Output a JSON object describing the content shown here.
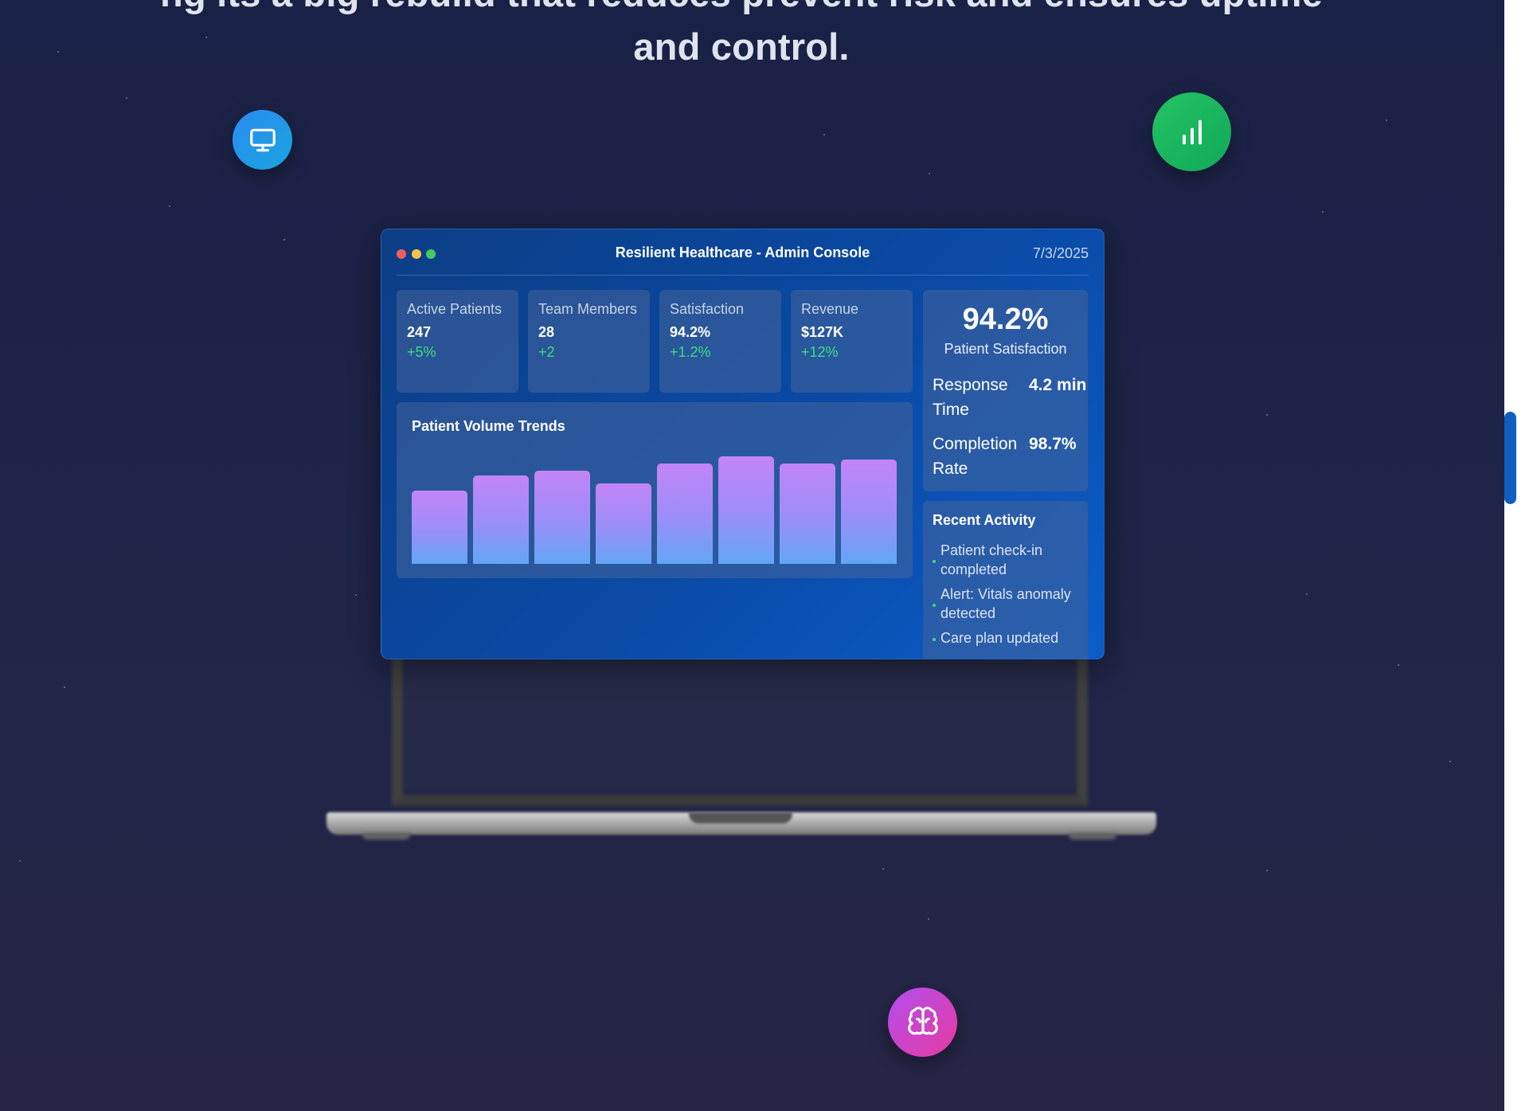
{
  "hero": {
    "heading_line1": "ng its a big rebuild that reduces prevent risk and ensures uptime",
    "heading_line2": "and control."
  },
  "floating_icons": [
    "monitor-icon",
    "bar-chart-icon",
    "brain-icon"
  ],
  "window": {
    "title": "Resilient Healthcare - Admin Console",
    "date": "7/3/2025",
    "stats": [
      {
        "label": "Active Patients",
        "value": "247",
        "change": "+5%"
      },
      {
        "label": "Team Members",
        "value": "28",
        "change": "+2"
      },
      {
        "label": "Satisfaction",
        "value": "94.2%",
        "change": "+1.2%"
      },
      {
        "label": "Revenue",
        "value": "$127K",
        "change": "+12%"
      }
    ],
    "kpi": {
      "big_value": "94.2%",
      "big_label": "Patient Satisfaction",
      "rows": [
        {
          "label": "Response Time",
          "value": "4.2 min"
        },
        {
          "label": "Completion Rate",
          "value": "98.7%"
        }
      ]
    },
    "activity": {
      "title": "Recent Activity",
      "items": [
        "Patient check-in completed",
        "Alert: Vitals anomaly detected",
        "Care plan updated"
      ]
    }
  },
  "chart_data": {
    "type": "bar",
    "title": "Patient Volume Trends",
    "values": [
      61,
      74,
      78,
      67,
      84,
      90,
      84,
      87
    ],
    "ylim": [
      0,
      100
    ],
    "colors": {
      "top": "#c384f7",
      "bottom": "#62a6f6"
    }
  },
  "colors": {
    "accent": "#0a4aa6",
    "positive": "#3fdc83",
    "scroll_thumb": "#0d5fc4"
  }
}
